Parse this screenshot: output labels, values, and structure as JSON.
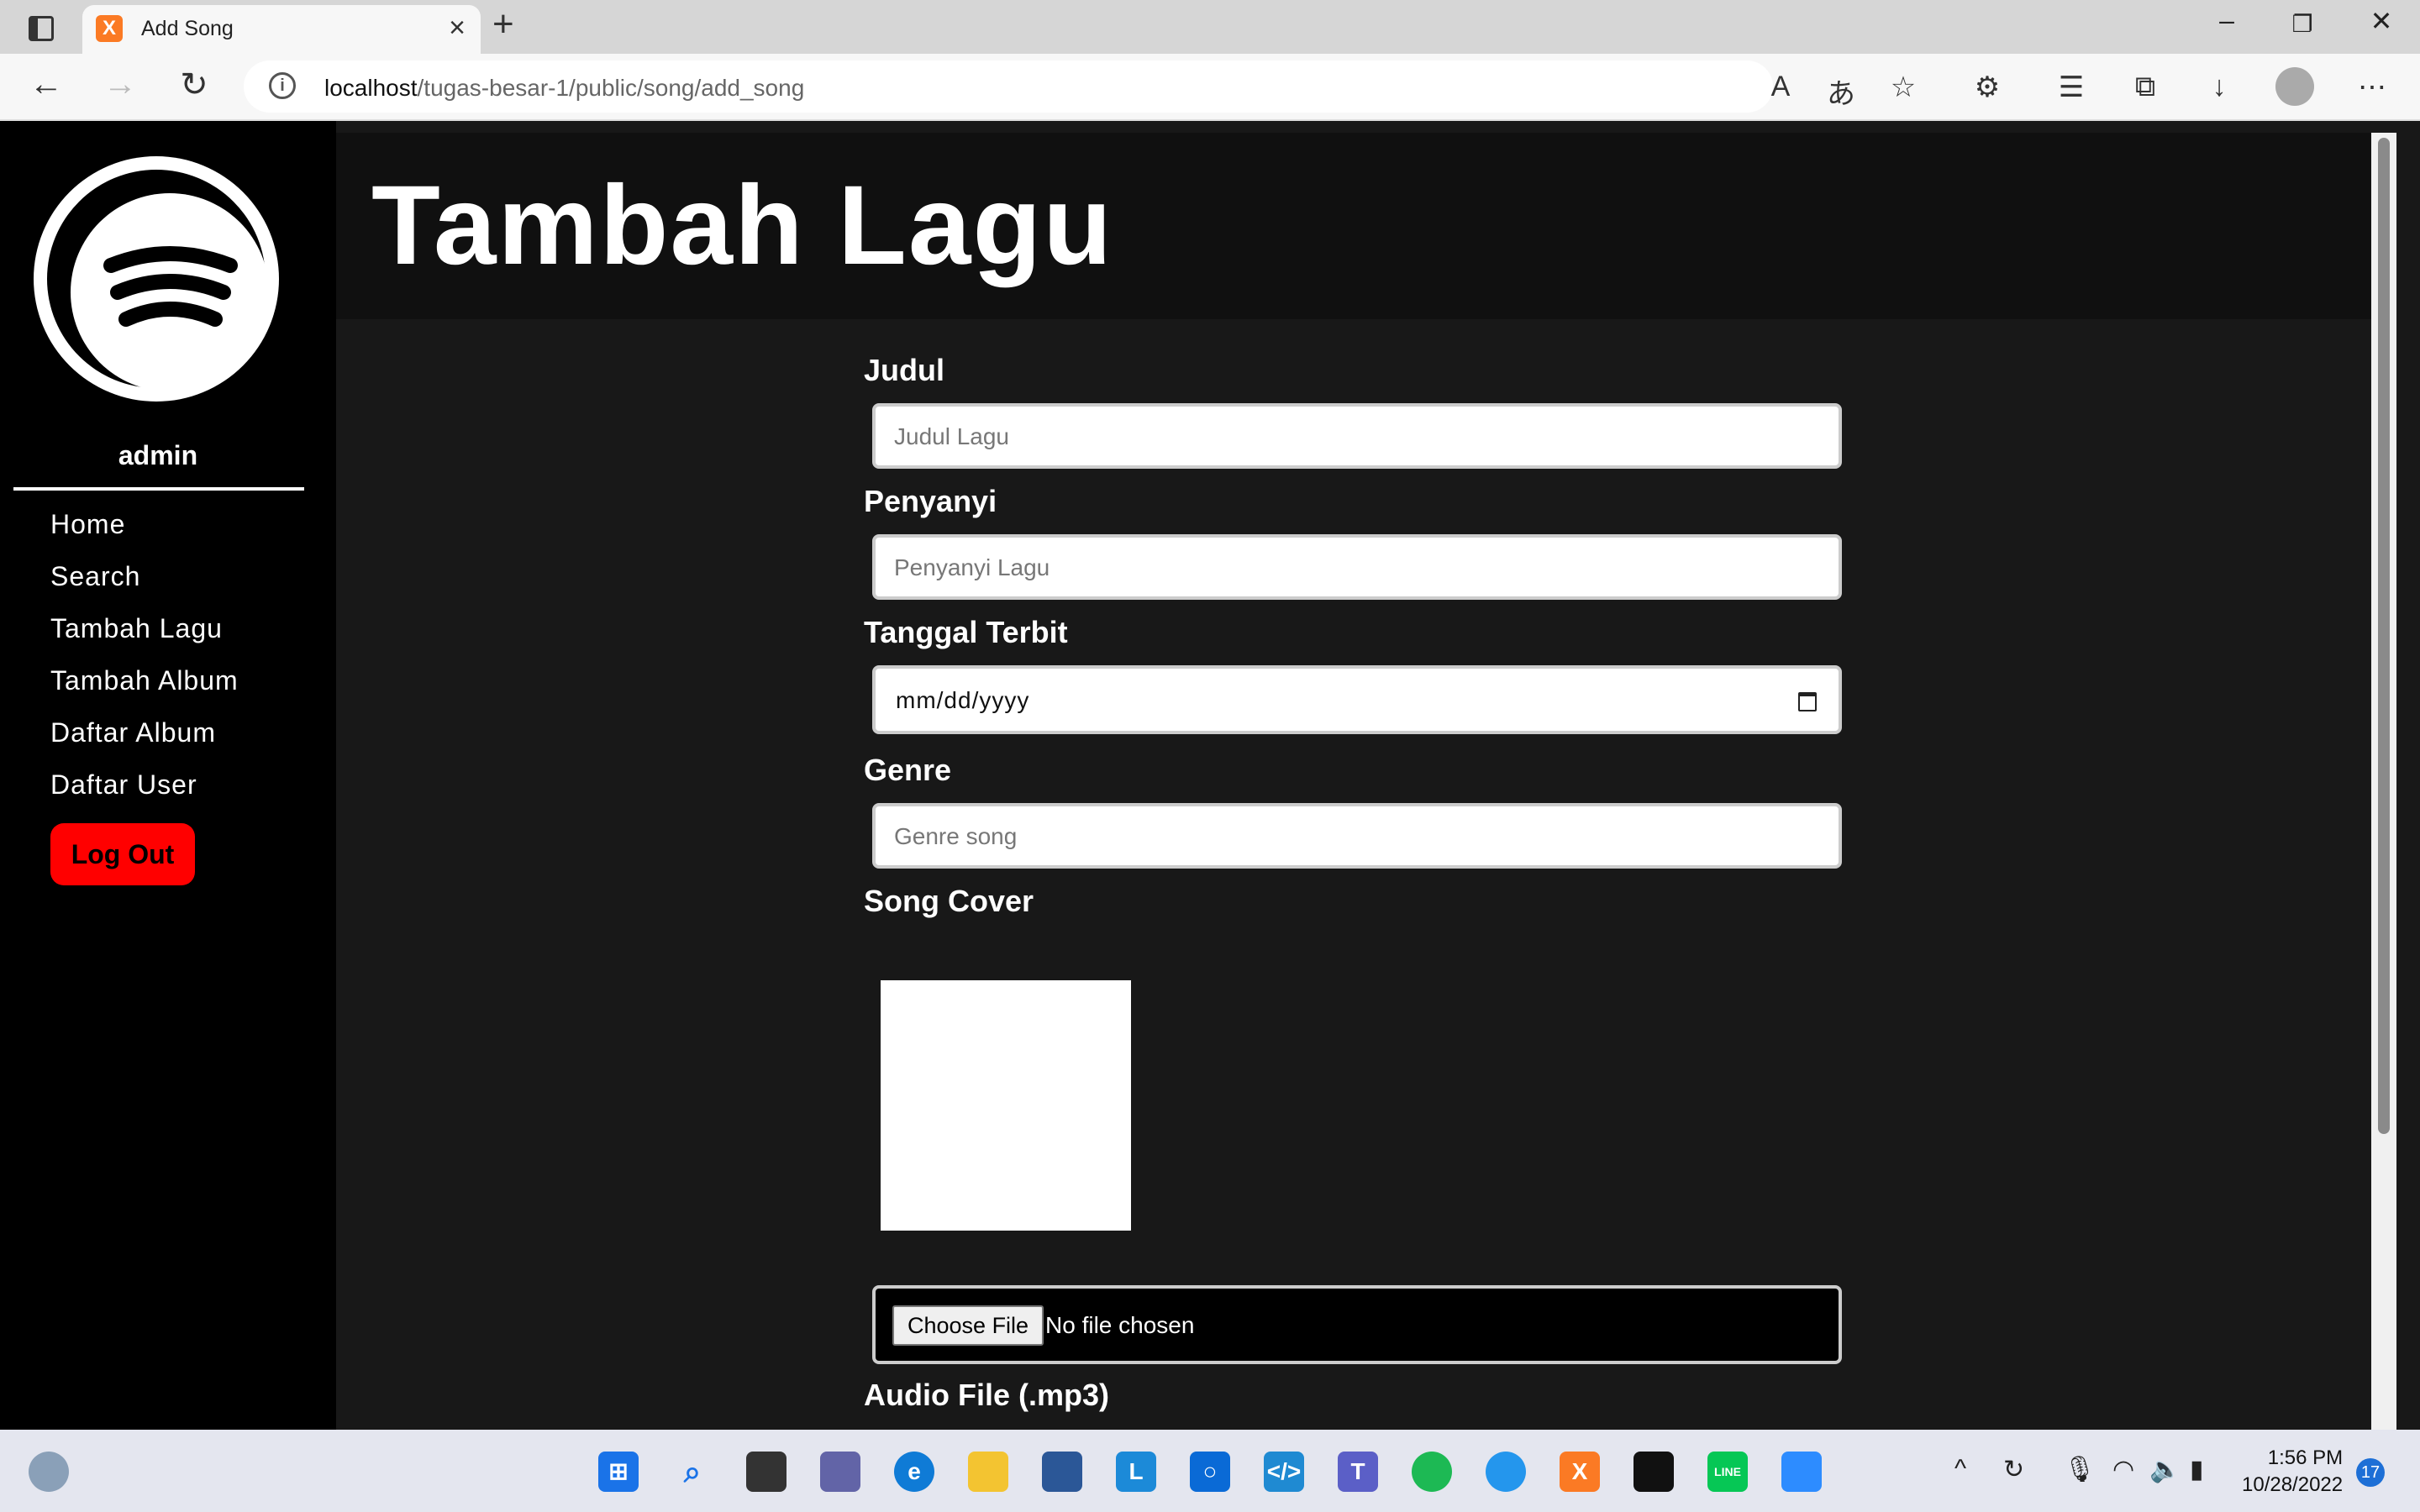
{
  "browser": {
    "tab_title": "Add Song",
    "tab_favicon": "xampp-icon",
    "url_host": "localhost",
    "url_path": "/tugas-besar-1/public/song/add_song"
  },
  "sidebar": {
    "username": "admin",
    "items": [
      {
        "label": "Home"
      },
      {
        "label": "Search"
      },
      {
        "label": "Tambah Lagu"
      },
      {
        "label": "Tambah Album"
      },
      {
        "label": "Daftar Album"
      },
      {
        "label": "Daftar User"
      }
    ],
    "logout_label": "Log Out"
  },
  "page": {
    "title": "Tambah Lagu"
  },
  "form": {
    "judul_label": "Judul",
    "judul_placeholder": "Judul Lagu",
    "penyanyi_label": "Penyanyi",
    "penyanyi_placeholder": "Penyanyi Lagu",
    "tanggal_label": "Tanggal Terbit",
    "tanggal_value": "mm/dd/yyyy",
    "genre_label": "Genre",
    "genre_placeholder": "Genre song",
    "cover_label": "Song Cover",
    "file_button": "Choose File",
    "file_status": "No file chosen",
    "audio_label": "Audio File (.mp3)"
  },
  "taskbar": {
    "time": "1:56 PM",
    "date": "10/28/2022",
    "notifications": "17"
  },
  "colors": {
    "logout": "#ff0000",
    "page_bg": "#181818",
    "sidebar_bg": "#000000"
  }
}
